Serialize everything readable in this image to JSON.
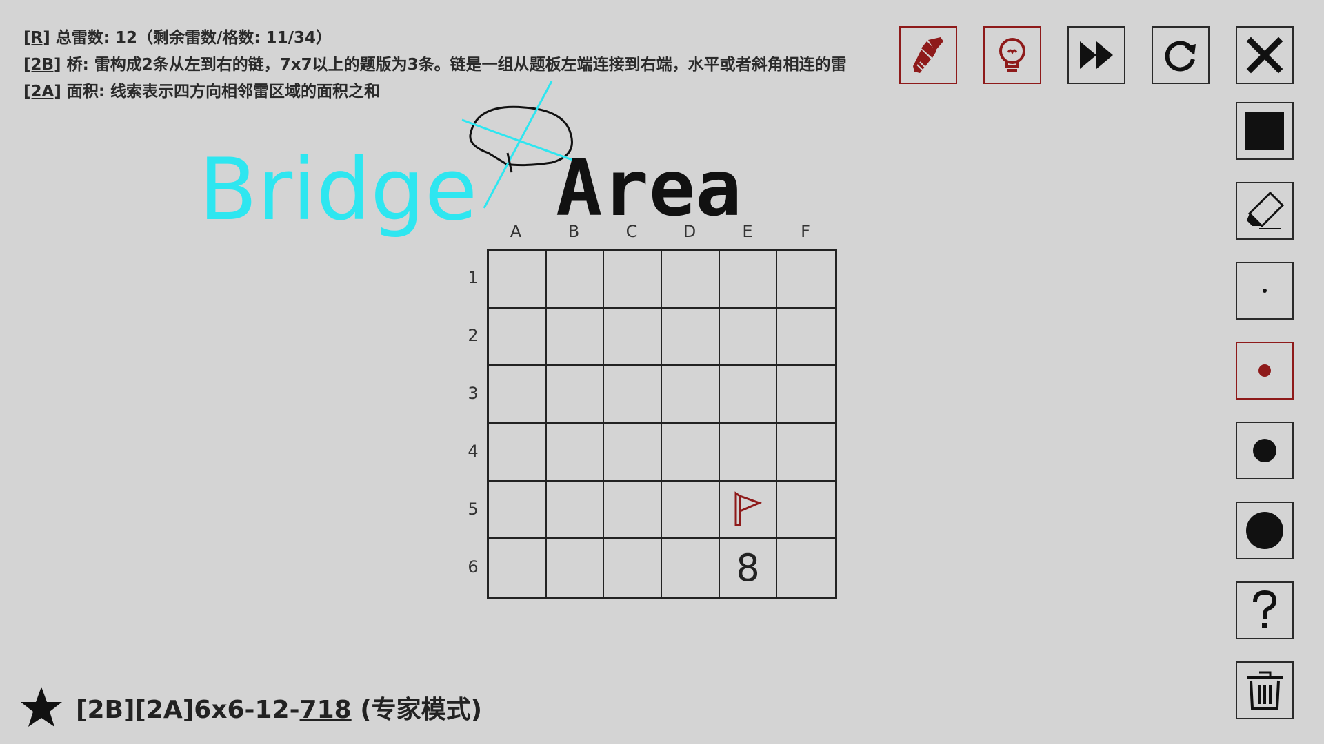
{
  "rules": {
    "line_r_tag": "[R]",
    "line_r_text": " 总雷数: 12（剩余雷数/格数: 11/34）",
    "line_2b_tag": "[2B]",
    "line_2b_text": " 桥: 雷构成2条从左到右的链，7x7以上的题版为3条。链是一组从题板左端连接到右端，水平或者斜角相连的雷",
    "line_2a_tag": "[2A]",
    "line_2a_text": " 面积: 线索表示四方向相邻雷区域的面积之和"
  },
  "annotations": {
    "bridge_word": "Bridge",
    "area_word": "Area",
    "bridge_color": "#2ee6f0",
    "area_color": "#111111"
  },
  "board": {
    "columns": [
      "A",
      "B",
      "C",
      "D",
      "E",
      "F"
    ],
    "rows": [
      "1",
      "2",
      "3",
      "4",
      "5",
      "6"
    ],
    "cells": {
      "E5": {
        "type": "flag"
      },
      "E6": {
        "type": "number",
        "value": "8"
      }
    }
  },
  "toolbar": {
    "top": [
      {
        "name": "brush-button",
        "icon": "brush-icon",
        "color": "#8e1a1a"
      },
      {
        "name": "hint-button",
        "icon": "lightbulb-icon",
        "color": "#8e1a1a"
      },
      {
        "name": "fast-forward-button",
        "icon": "fast-forward-icon",
        "color": "#111111"
      },
      {
        "name": "restart-button",
        "icon": "restart-icon",
        "color": "#111111"
      },
      {
        "name": "close-button",
        "icon": "close-icon",
        "color": "#111111"
      }
    ],
    "side": [
      {
        "name": "fill-black-tool",
        "icon": "black-square-icon"
      },
      {
        "name": "eraser-tool",
        "icon": "eraser-icon"
      },
      {
        "name": "tiny-dot-tool",
        "icon": "tiny-dot-icon"
      },
      {
        "name": "red-dot-tool",
        "icon": "red-dot-icon",
        "selected": true
      },
      {
        "name": "medium-dot-tool",
        "icon": "medium-dot-icon"
      },
      {
        "name": "large-dot-tool",
        "icon": "large-dot-icon"
      },
      {
        "name": "question-tool",
        "icon": "question-icon"
      },
      {
        "name": "trash-tool",
        "icon": "trash-icon"
      }
    ]
  },
  "footer": {
    "icon": "star-icon",
    "prefix": "[2B][2A]6x6-12-",
    "puzzle_id": "718",
    "mode": " (专家模式)"
  },
  "colors": {
    "background": "#d4d4d4",
    "accent_red": "#8e1a1a",
    "grid": "#222222"
  }
}
